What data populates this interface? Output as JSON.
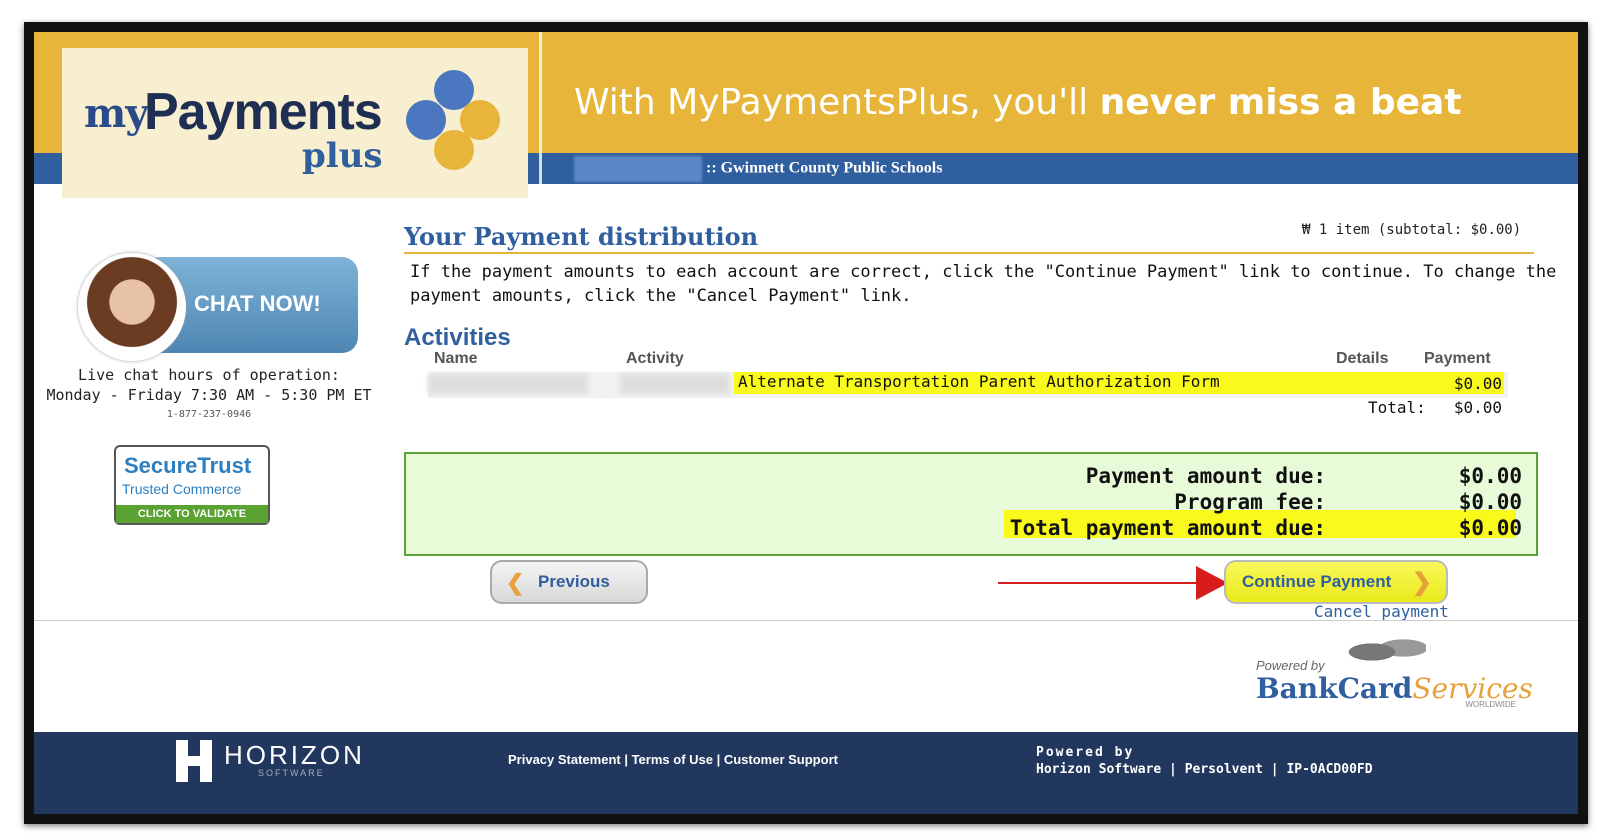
{
  "header": {
    "logo": {
      "my": "my",
      "payments": "Payments",
      "plus": "plus"
    },
    "tagline_pre": "With MyPaymentsPlus, you'll ",
    "tagline_bold": "never miss a beat",
    "school": ":: Gwinnett County Public Schools"
  },
  "chat": {
    "button_label": "CHAT NOW!",
    "hours_title": "Live chat hours of operation:",
    "hours": "Monday - Friday 7:30 AM - 5:30 PM ET",
    "phone": "1-877-237-0946"
  },
  "secure_trust": {
    "brand": "SecureTrust",
    "sub": "Trusted Commerce",
    "validate": "CLICK TO VALIDATE"
  },
  "main": {
    "title": "Your Payment distribution",
    "cart": "1 item  (subtotal: $0.00)",
    "instructions": "If the payment amounts to each account are correct, click the \"Continue Payment\" link to continue. To change the payment amounts, click the \"Cancel Payment\" link."
  },
  "activities": {
    "heading": "Activities",
    "columns": {
      "name": "Name",
      "activity": "Activity",
      "details": "Details",
      "payment": "Payment"
    },
    "row": {
      "form": "Alternate Transportation Parent Authorization Form",
      "payment": "$0.00"
    },
    "total_label": "Total:",
    "total_value": "$0.00"
  },
  "summary": {
    "due_label": "Payment amount due:",
    "due_value": "$0.00",
    "fee_label": "Program fee:",
    "fee_value": "$0.00",
    "total_label": "Total payment amount due:",
    "total_value": "$0.00"
  },
  "actions": {
    "previous": "Previous",
    "continue": "Continue Payment",
    "cancel": "Cancel payment"
  },
  "bankcard": {
    "powered": "Powered by",
    "name": "BankCard",
    "services": "Services",
    "worldwide": "WORLDWIDE"
  },
  "footer": {
    "brand": "HORIZON",
    "brand_sub": "SOFTWARE",
    "links": "Privacy Statement | Terms of Use | Customer Support",
    "powered_title": "Powered by",
    "powered_by": "Horizon Software | Persolvent | IP-0ACD00FD"
  },
  "colors": {
    "gold": "#e7b53a",
    "blue": "#2f5f9e",
    "navy": "#22375e",
    "highlight": "#f9f91b",
    "green": "#5aa232"
  }
}
